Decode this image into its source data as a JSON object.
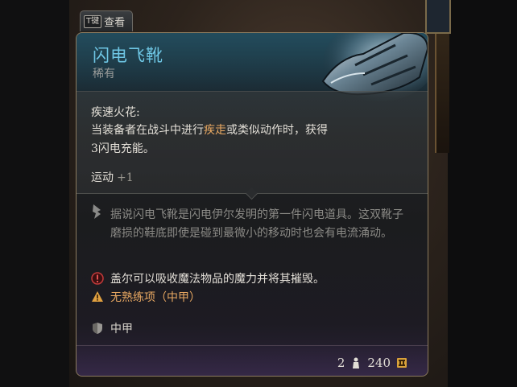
{
  "view_tab": {
    "key": "T键",
    "label": "查看"
  },
  "item": {
    "name": "闪电飞靴",
    "rarity": "稀有",
    "passive": {
      "title": "疾速火花:",
      "desc_pre": "当装备者在战斗中进行",
      "desc_hl": "疾走",
      "desc_post": "或类似动作时，获得3闪电充能。"
    },
    "bonus": {
      "label": "运动",
      "value": "+1"
    },
    "lore": "据说闪电飞靴是闪电伊尔发明的第一件闪电道具。这双靴子磨损的鞋底即使是碰到最微小的移动时也会有电流涌动。",
    "special": "盖尔可以吸收魔法物品的魔力并将其摧毁。",
    "proficiency": "无熟练项（中甲）",
    "armor_type": "中甲",
    "weight": "2",
    "value": "240"
  },
  "colors": {
    "name": "#6ec6e4",
    "highlight": "#e8a862",
    "text": "#e2ded6",
    "lore": "#8b8a86"
  },
  "icons": {
    "lore": "feather-icon",
    "special": "warning-circle-icon",
    "proficiency": "warning-triangle-icon",
    "armor": "shield-icon",
    "weight": "weight-icon",
    "value": "coin-icon"
  }
}
